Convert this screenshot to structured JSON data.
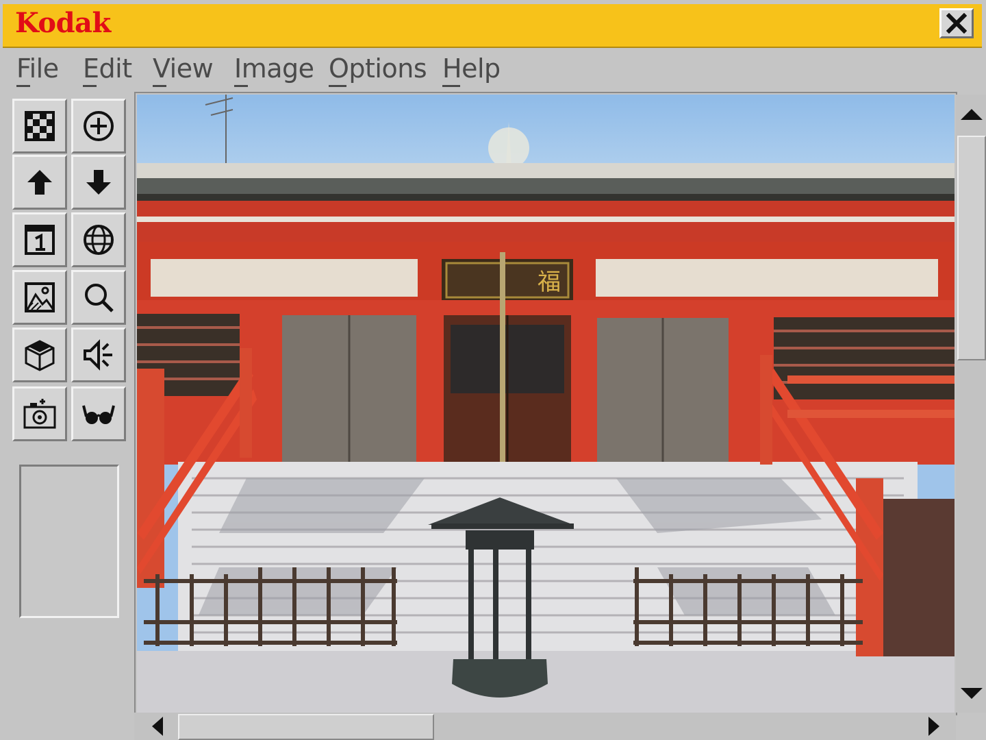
{
  "app": {
    "brand": "Kodak",
    "accent_color": "#f7c21a",
    "brand_color": "#e10d16"
  },
  "window": {
    "close_icon": "close-icon"
  },
  "menu": [
    {
      "label": "File"
    },
    {
      "label": "Edit"
    },
    {
      "label": "View"
    },
    {
      "label": "Image"
    },
    {
      "label": "Options"
    },
    {
      "label": "Help"
    }
  ],
  "toolbar": {
    "tools": [
      {
        "icon": "checkerboard-icon"
      },
      {
        "icon": "zoom-plus-icon"
      },
      {
        "icon": "arrow-up-icon"
      },
      {
        "icon": "arrow-down-icon"
      },
      {
        "icon": "calendar-one-icon"
      },
      {
        "icon": "globe-icon"
      },
      {
        "icon": "picture-icon"
      },
      {
        "icon": "magnifier-icon"
      },
      {
        "icon": "cube-icon"
      },
      {
        "icon": "speaker-icon"
      },
      {
        "icon": "camera-icon"
      },
      {
        "icon": "glasses-icon"
      }
    ]
  },
  "image": {
    "subject": "temple-photo",
    "plaque_text": "福"
  },
  "scroll": {
    "vertical": {
      "up_icon": "scroll-up-icon",
      "down_icon": "scroll-down-icon"
    },
    "horizontal": {
      "left_icon": "scroll-left-icon",
      "right_icon": "scroll-right-icon"
    }
  }
}
